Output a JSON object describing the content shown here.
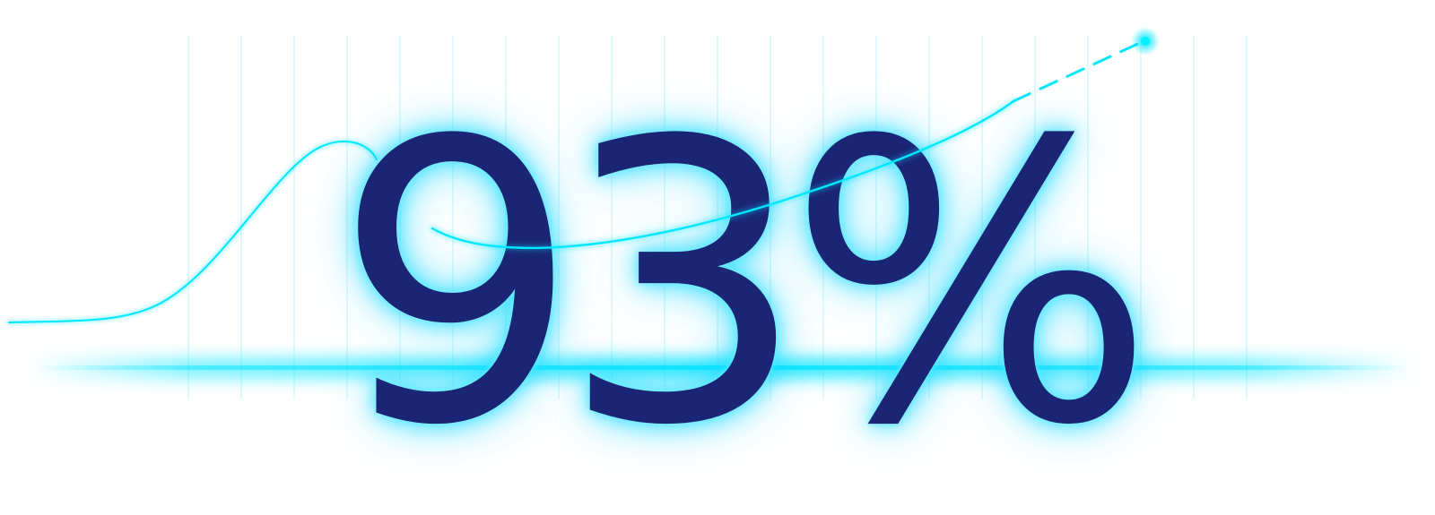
{
  "statistic": {
    "value": "93%"
  },
  "colors": {
    "text": "#1b2575",
    "glow": "#00e5ff",
    "line": "#00e8ff",
    "gridline": "#bdf3f8",
    "background": "#ffffff"
  }
}
